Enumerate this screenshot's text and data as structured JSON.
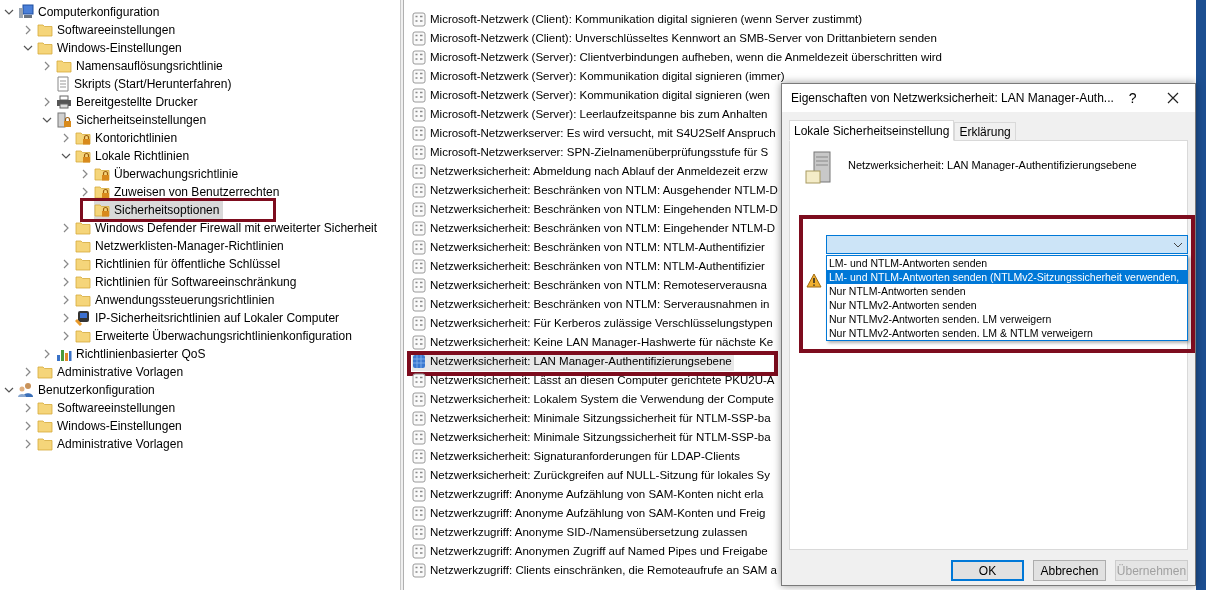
{
  "tree": [
    {
      "label": "Computerkonfiguration",
      "kind": "computer",
      "expanded": true,
      "selected": false,
      "children": [
        {
          "label": "Softwareeinstellungen",
          "kind": "folder",
          "expanded": false,
          "selected": false
        },
        {
          "label": "Windows-Einstellungen",
          "kind": "folder",
          "expanded": true,
          "selected": false,
          "children": [
            {
              "label": "Namensauflösungsrichtlinie",
              "kind": "folder",
              "expanded": false,
              "selected": false
            },
            {
              "label": "Skripts (Start/Herunterfahren)",
              "kind": "script",
              "selected": false
            },
            {
              "label": "Bereitgestellte Drucker",
              "kind": "printer",
              "expanded": false,
              "selected": false
            },
            {
              "label": "Sicherheitseinstellungen",
              "kind": "security",
              "expanded": true,
              "selected": false,
              "children": [
                {
                  "label": "Kontorichtlinien",
                  "kind": "secure-folder",
                  "expanded": false,
                  "selected": false
                },
                {
                  "label": "Lokale Richtlinien",
                  "kind": "secure-folder",
                  "expanded": true,
                  "selected": false,
                  "children": [
                    {
                      "label": "Überwachungsrichtlinie",
                      "kind": "secure-folder",
                      "expanded": false,
                      "selected": false
                    },
                    {
                      "label": "Zuweisen von Benutzerrechten",
                      "kind": "secure-folder",
                      "expanded": false,
                      "selected": false
                    },
                    {
                      "label": "Sicherheitsoptionen",
                      "kind": "secure-folder",
                      "selected": true
                    }
                  ]
                },
                {
                  "label": "Windows Defender Firewall mit erweiterter Sicherheit",
                  "kind": "folder",
                  "expanded": false,
                  "selected": false
                },
                {
                  "label": "Netzwerklisten-Manager-Richtlinien",
                  "kind": "folder",
                  "selected": false
                },
                {
                  "label": "Richtlinien für öffentliche Schlüssel",
                  "kind": "folder",
                  "expanded": false,
                  "selected": false
                },
                {
                  "label": "Richtlinien für Softwareeinschränkung",
                  "kind": "folder",
                  "expanded": false,
                  "selected": false
                },
                {
                  "label": "Anwendungssteuerungsrichtlinien",
                  "kind": "folder",
                  "expanded": false,
                  "selected": false
                },
                {
                  "label": "IP-Sicherheitsrichtlinien auf Lokaler Computer",
                  "kind": "ipsec",
                  "expanded": false,
                  "selected": false
                },
                {
                  "label": "Erweiterte Überwachungsrichtlinienkonfiguration",
                  "kind": "folder",
                  "expanded": false,
                  "selected": false
                }
              ]
            },
            {
              "label": "Richtlinienbasierter QoS",
              "kind": "qos",
              "expanded": false,
              "selected": false
            }
          ]
        },
        {
          "label": "Administrative Vorlagen",
          "kind": "folder",
          "expanded": false,
          "selected": false
        }
      ]
    },
    {
      "label": "Benutzerkonfiguration",
      "kind": "users",
      "expanded": true,
      "selected": false,
      "children": [
        {
          "label": "Softwareeinstellungen",
          "kind": "folder",
          "expanded": false,
          "selected": false
        },
        {
          "label": "Windows-Einstellungen",
          "kind": "folder",
          "expanded": false,
          "selected": false
        },
        {
          "label": "Administrative Vorlagen",
          "kind": "folder",
          "expanded": false,
          "selected": false
        }
      ]
    }
  ],
  "policies": [
    {
      "label": "Microsoft-Netzwerk (Client): Kommunikation digital signieren (wenn Server zustimmt)",
      "selected": false
    },
    {
      "label": "Microsoft-Netzwerk (Client): Unverschlüsseltes Kennwort an SMB-Server von Drittanbietern senden",
      "selected": false
    },
    {
      "label": "Microsoft-Netzwerk (Server): Clientverbindungen aufheben, wenn die Anmeldezeit überschritten wird",
      "selected": false
    },
    {
      "label": "Microsoft-Netzwerk (Server): Kommunikation digital signieren (immer)",
      "selected": false
    },
    {
      "label": "Microsoft-Netzwerk (Server): Kommunikation digital signieren (wen",
      "selected": false
    },
    {
      "label": "Microsoft-Netzwerk (Server): Leerlaufzeitspanne bis zum Anhalten",
      "selected": false
    },
    {
      "label": "Microsoft-Netzwerkserver: Es wird versucht, mit S4U2Self Anspruch",
      "selected": false
    },
    {
      "label": "Microsoft-Netzwerkserver: SPN-Zielnamenüberprüfungsstufe für S",
      "selected": false
    },
    {
      "label": "Netzwerksicherheit: Abmeldung nach Ablauf der Anmeldezeit erzw",
      "selected": false
    },
    {
      "label": "Netzwerksicherheit: Beschränken von NTLM: Ausgehender NTLM-D",
      "selected": false
    },
    {
      "label": "Netzwerksicherheit: Beschränken von NTLM: Eingehenden NTLM-D",
      "selected": false
    },
    {
      "label": "Netzwerksicherheit: Beschränken von NTLM: Eingehender NTLM-D",
      "selected": false
    },
    {
      "label": "Netzwerksicherheit: Beschränken von NTLM: NTLM-Authentifizier",
      "selected": false
    },
    {
      "label": "Netzwerksicherheit: Beschränken von NTLM: NTLM-Authentifizier",
      "selected": false
    },
    {
      "label": "Netzwerksicherheit: Beschränken von NTLM: Remoteserverausna",
      "selected": false
    },
    {
      "label": "Netzwerksicherheit: Beschränken von NTLM: Serverausnahmen in",
      "selected": false
    },
    {
      "label": "Netzwerksicherheit: Für Kerberos zulässige Verschlüsselungstypen",
      "selected": false
    },
    {
      "label": "Netzwerksicherheit: Keine LAN Manager-Hashwerte für nächste Ke",
      "selected": false
    },
    {
      "label": "Netzwerksicherheit: LAN Manager-Authentifizierungsebene",
      "selected": true
    },
    {
      "label": "Netzwerksicherheit: Lässt an diesen Computer gerichtete PKU2U-A",
      "selected": false
    },
    {
      "label": "Netzwerksicherheit: Lokalem System die Verwendung der Compute",
      "selected": false
    },
    {
      "label": "Netzwerksicherheit: Minimale Sitzungssicherheit für NTLM-SSP-ba",
      "selected": false
    },
    {
      "label": "Netzwerksicherheit: Minimale Sitzungssicherheit für NTLM-SSP-ba",
      "selected": false
    },
    {
      "label": "Netzwerksicherheit: Signaturanforderungen für LDAP-Clients",
      "selected": false
    },
    {
      "label": "Netzwerksicherheit: Zurückgreifen auf NULL-Sitzung für lokales Sy",
      "selected": false
    },
    {
      "label": "Netzwerkzugriff: Anonyme Aufzählung von SAM-Konten nicht erla",
      "selected": false
    },
    {
      "label": "Netzwerkzugriff: Anonyme Aufzählung von SAM-Konten und Freig",
      "selected": false
    },
    {
      "label": "Netzwerkzugriff: Anonyme SID-/Namensübersetzung zulassen",
      "selected": false
    },
    {
      "label": "Netzwerkzugriff: Anonymen Zugriff auf Named Pipes und Freigabe",
      "selected": false
    },
    {
      "label": "Netzwerkzugriff: Clients einschränken, die Remoteaufrufe an SAM a",
      "selected": false
    }
  ],
  "dialog": {
    "title": "Eigenschaften von Netzwerksicherheit: LAN Manager-Auth...",
    "help": "?",
    "tabs": [
      {
        "label": "Lokale Sicherheitseinstellung",
        "selected": true
      },
      {
        "label": "Erklärung",
        "selected": false
      }
    ],
    "policy_name": "Netzwerksicherheit: LAN Manager-Authentifizierungsebene",
    "dropdown": {
      "expanded": true,
      "options": [
        {
          "label": "LM- und NTLM-Antworten senden",
          "selected": false
        },
        {
          "label": "LM- und NTLM-Antworten senden (NTLMv2-Sitzungssicherheit verwenden,",
          "selected": true
        },
        {
          "label": "Nur NTLM-Antworten senden",
          "selected": false
        },
        {
          "label": "Nur NTLMv2-Antworten senden",
          "selected": false
        },
        {
          "label": "Nur NTLMv2-Antworten senden. LM verweigern",
          "selected": false
        },
        {
          "label": "Nur NTLMv2-Antworten senden. LM & NTLM verweigern",
          "selected": false
        }
      ]
    },
    "buttons": [
      {
        "label": "OK",
        "default": true,
        "disabled": false
      },
      {
        "label": "Abbrechen",
        "default": false,
        "disabled": false
      },
      {
        "label": "Übernehmen",
        "default": false,
        "disabled": true
      }
    ]
  }
}
